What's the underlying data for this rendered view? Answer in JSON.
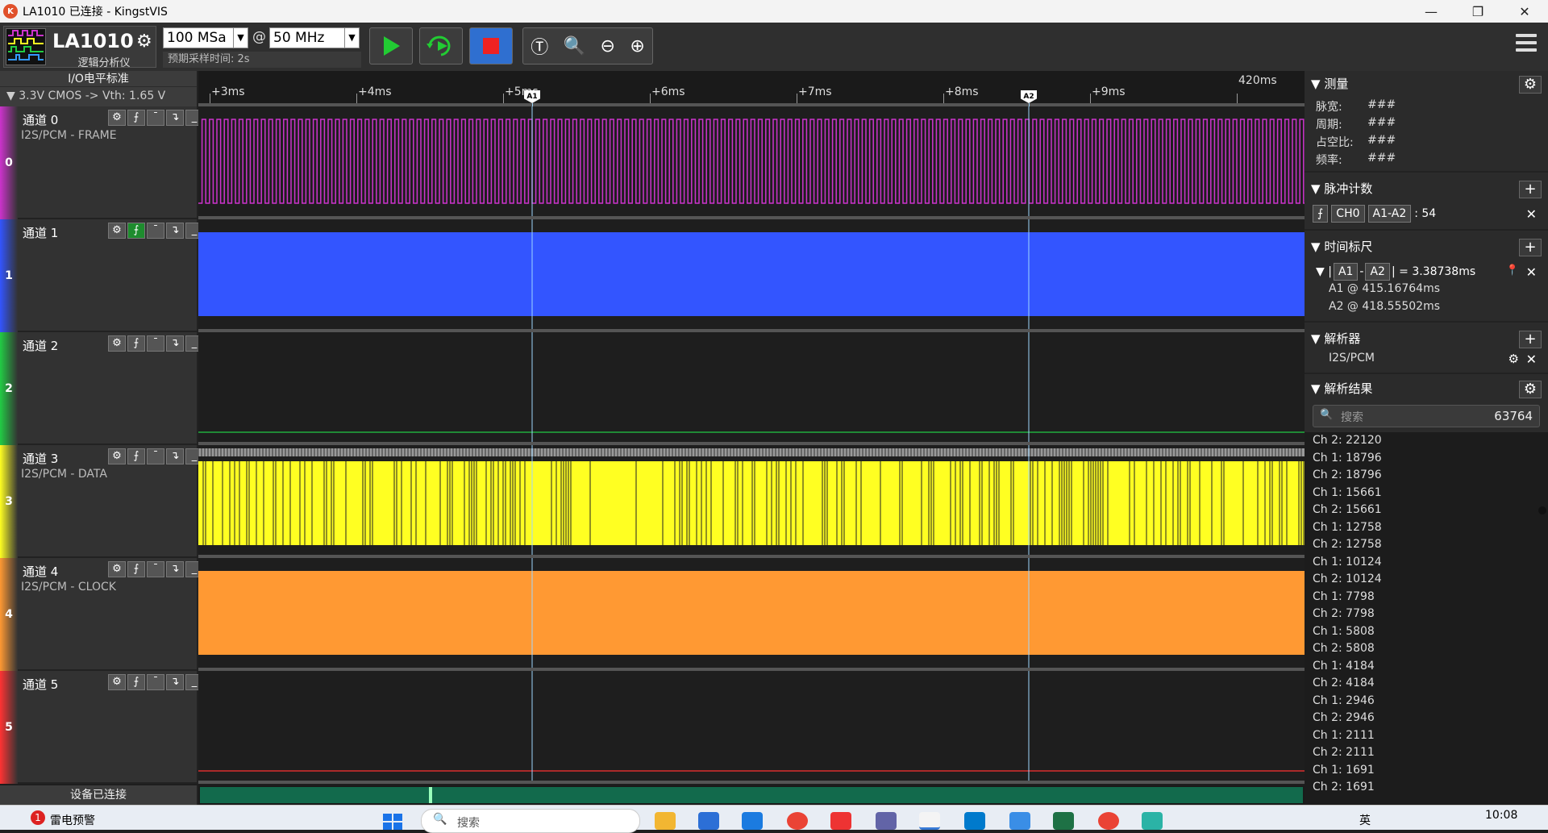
{
  "window": {
    "title": "LA1010 已连接 - KingstVIS",
    "controls": [
      "—",
      "❐",
      "✕"
    ]
  },
  "toolbar": {
    "device_name": "LA1010",
    "device_subtitle": "逻辑分析仪",
    "sample_depth": "100 MSa",
    "at_sign": "@",
    "sample_rate": "50 MHz",
    "estimated_time": "预期采样时间: 2s"
  },
  "io_standard": {
    "title": "I/O电平标准",
    "value": "▼ 3.3V CMOS  -> Vth: 1.65 V"
  },
  "ruler": {
    "top_label": "420ms",
    "ticks": [
      "+3ms",
      "+4ms",
      "+5ms",
      "+6ms",
      "+7ms",
      "+8ms",
      "+9ms"
    ],
    "cursor_a1": "A1",
    "cursor_a2": "A2"
  },
  "channels": [
    {
      "name": "通道 0",
      "decoder": "I2S/PCM - FRAME",
      "index": "0",
      "color": "#cc33cc"
    },
    {
      "name": "通道 1",
      "decoder": "",
      "index": "1",
      "color": "#3355ff"
    },
    {
      "name": "通道 2",
      "decoder": "",
      "index": "2",
      "color": "#22cc44"
    },
    {
      "name": "通道 3",
      "decoder": "I2S/PCM - DATA",
      "index": "3",
      "color": "#ffff22"
    },
    {
      "name": "通道 4",
      "decoder": "I2S/PCM - CLOCK",
      "index": "4",
      "color": "#ff9933"
    },
    {
      "name": "通道 5",
      "decoder": "",
      "index": "5",
      "color": "#ff3333"
    }
  ],
  "status": {
    "text": "设备已连接"
  },
  "measure": {
    "title": "测量",
    "pulse_width_label": "脉宽:",
    "pulse_width": "###",
    "period_label": "周期:",
    "period": "###",
    "duty_label": "占空比:",
    "duty": "###",
    "freq_label": "频率:",
    "freq": "###"
  },
  "pulse_count": {
    "title": "脉冲计数",
    "channel": "CH0",
    "range": "A1-A2",
    "value": ": 54"
  },
  "time_markers": {
    "title": "时间标尺",
    "a1": "A1",
    "a2": "A2",
    "delta_value": "| = 3.38738ms",
    "a1_pos": "A1 @ 415.16764ms",
    "a2_pos": "A2 @ 418.55502ms"
  },
  "analyzers": {
    "title": "解析器",
    "item": "I2S/PCM"
  },
  "results": {
    "title": "解析结果",
    "search_placeholder": "搜索",
    "count": "63764",
    "items": [
      "Ch 2: 22120",
      "Ch 1: 18796",
      "Ch 2: 18796",
      "Ch 1: 15661",
      "Ch 2: 15661",
      "Ch 1: 12758",
      "Ch 2: 12758",
      "Ch 1: 10124",
      "Ch 2: 10124",
      "Ch 1: 7798",
      "Ch 2: 7798",
      "Ch 1: 5808",
      "Ch 2: 5808",
      "Ch 1: 4184",
      "Ch 2: 4184",
      "Ch 1: 2946",
      "Ch 2: 2946",
      "Ch 1: 2111",
      "Ch 2: 2111",
      "Ch 1: 1691",
      "Ch 2: 1691"
    ]
  },
  "taskbar": {
    "notification_badge": "1",
    "weather": "雷电预警",
    "search_placeholder": "搜索",
    "lang": "英",
    "time": "10:08"
  },
  "colors": {
    "ch0": "#cc33cc",
    "ch1": "#3355ff",
    "ch2": "#22cc44",
    "ch3": "#ffff22",
    "ch4": "#ff9933",
    "ch5": "#ff3333",
    "cursor_line": "#9fd6ff"
  }
}
